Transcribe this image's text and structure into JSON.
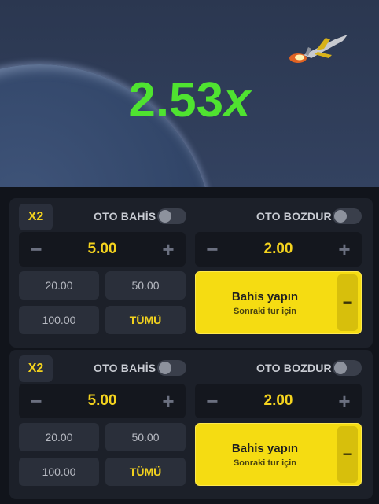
{
  "game": {
    "multiplier_value": "2.53",
    "multiplier_suffix": "x"
  },
  "panels": [
    {
      "x2_label": "X2",
      "auto_bet_label": "OTO BAHİS",
      "auto_bet_on": false,
      "auto_cashout_label": "OTO BOZDUR",
      "auto_cashout_on": false,
      "bet_amount": "5.00",
      "cashout_value": "2.00",
      "quick_amounts": [
        "20.00",
        "50.00",
        "100.00"
      ],
      "all_label": "TÜMÜ",
      "bet_button_title": "Bahis yapın",
      "bet_button_subtitle": "Sonraki tur için",
      "minus_symbol": "−",
      "plus_symbol": "+"
    },
    {
      "x2_label": "X2",
      "auto_bet_label": "OTO BAHİS",
      "auto_bet_on": false,
      "auto_cashout_label": "OTO BOZDUR",
      "auto_cashout_on": false,
      "bet_amount": "5.00",
      "cashout_value": "2.00",
      "quick_amounts": [
        "20.00",
        "50.00",
        "100.00"
      ],
      "all_label": "TÜMÜ",
      "bet_button_title": "Bahis yapın",
      "bet_button_subtitle": "Sonraki tur için",
      "minus_symbol": "−",
      "plus_symbol": "+"
    }
  ],
  "colors": {
    "multiplier": "#4fe330",
    "accent_yellow": "#f5dc12",
    "value_yellow": "#f4d31e",
    "sky": "#2b3750",
    "panel": "#1c2029"
  },
  "icons": {
    "plane": "jet-plane-icon",
    "minus": "minus-icon",
    "plus": "plus-icon"
  }
}
